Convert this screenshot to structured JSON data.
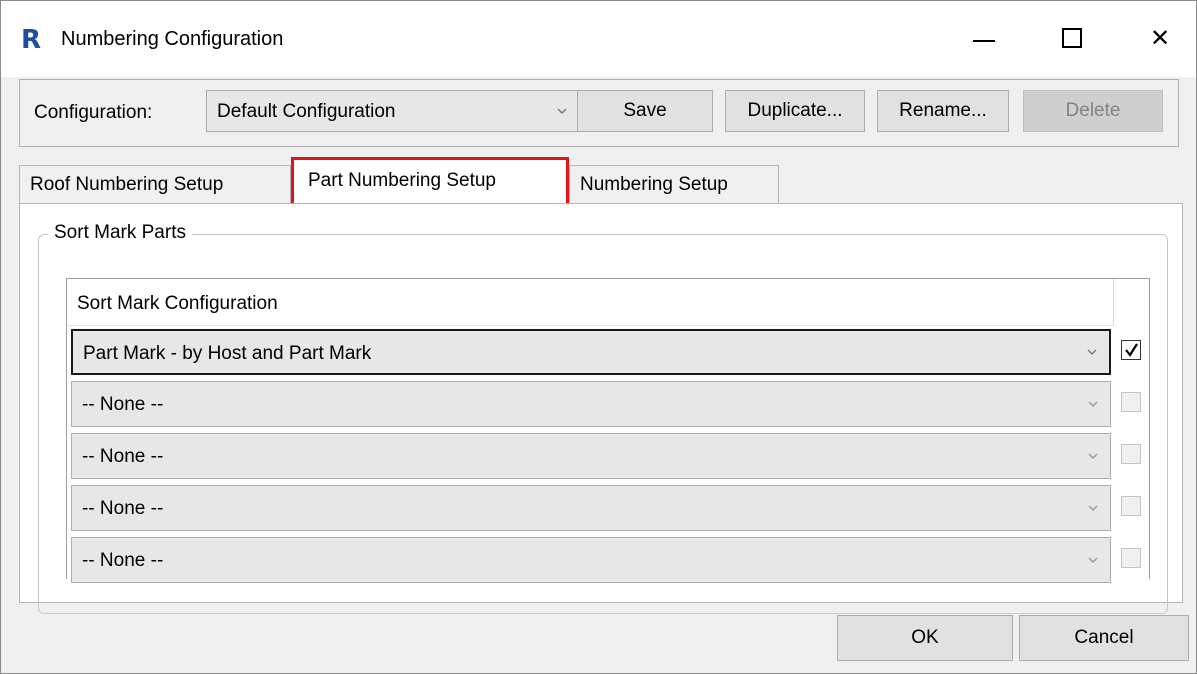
{
  "window": {
    "title": "Numbering Configuration",
    "app_icon_letter": "R",
    "close_glyph": "✕"
  },
  "config": {
    "label": "Configuration:",
    "selected": "Default Configuration",
    "save": "Save",
    "duplicate": "Duplicate...",
    "rename": "Rename...",
    "delete": "Delete"
  },
  "tabs": [
    {
      "label": "Roof Numbering Setup"
    },
    {
      "label": "Part Numbering Setup",
      "active": true
    },
    {
      "label": "Numbering Setup"
    }
  ],
  "sort_mark_parts": {
    "legend": "Sort Mark Parts",
    "column_header": "Sort Mark Configuration",
    "rows": [
      {
        "value": "Part Mark - by Host and Part Mark",
        "checked": true
      },
      {
        "value": "-- None --",
        "checked": false
      },
      {
        "value": "-- None --",
        "checked": false
      },
      {
        "value": "-- None --",
        "checked": false
      },
      {
        "value": "-- None --",
        "checked": false
      }
    ]
  },
  "footer": {
    "ok": "OK",
    "cancel": "Cancel"
  },
  "colors": {
    "highlight_border": "#e3141b",
    "app_icon": "#1f4e9c"
  }
}
